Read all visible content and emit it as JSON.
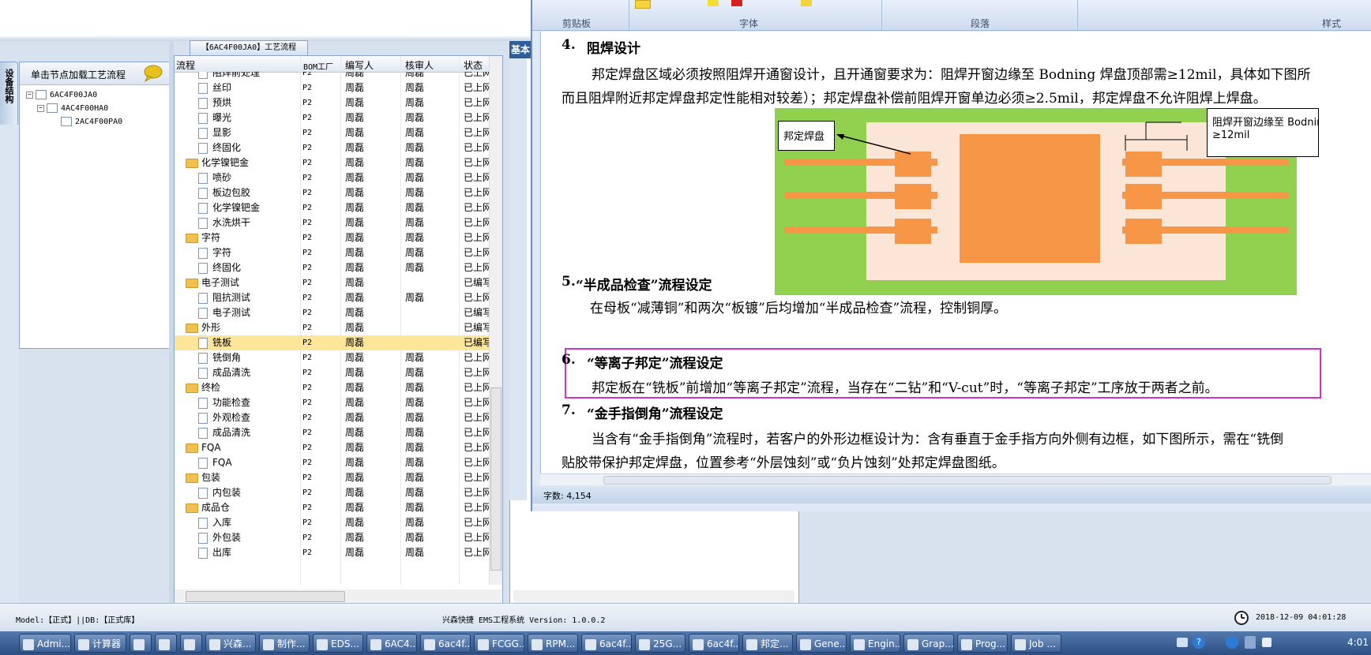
{
  "tree_panel": {
    "side_tab": "设备结构",
    "header": "单击节点加载工艺流程",
    "nodes": [
      "6AC4F00JA0",
      "4AC4F00HA0",
      "2AC4F00PA0"
    ]
  },
  "process": {
    "title": "【6AC4F00JA0】工艺流程",
    "headers": {
      "flow": "流程",
      "bom": "BOM工厂",
      "writer": "编写人",
      "reviewer": "核审人",
      "status": "状态"
    },
    "rows": [
      {
        "level": 2,
        "folder": false,
        "name": "阻焊前处理",
        "bom": "P2",
        "writer": "周磊",
        "reviewer": "周磊",
        "status": "已上网"
      },
      {
        "level": 2,
        "folder": false,
        "name": "丝印",
        "bom": "P2",
        "writer": "周磊",
        "reviewer": "周磊",
        "status": "已上网"
      },
      {
        "level": 2,
        "folder": false,
        "name": "预烘",
        "bom": "P2",
        "writer": "周磊",
        "reviewer": "周磊",
        "status": "已上网"
      },
      {
        "level": 2,
        "folder": false,
        "name": "曝光",
        "bom": "P2",
        "writer": "周磊",
        "reviewer": "周磊",
        "status": "已上网"
      },
      {
        "level": 2,
        "folder": false,
        "name": "显影",
        "bom": "P2",
        "writer": "周磊",
        "reviewer": "周磊",
        "status": "已上网"
      },
      {
        "level": 2,
        "folder": false,
        "name": "终固化",
        "bom": "P2",
        "writer": "周磊",
        "reviewer": "周磊",
        "status": "已上网"
      },
      {
        "level": 1,
        "folder": true,
        "name": "化学镍钯金",
        "bom": "P2",
        "writer": "周磊",
        "reviewer": "周磊",
        "status": "已上网"
      },
      {
        "level": 2,
        "folder": false,
        "name": "喷砂",
        "bom": "P2",
        "writer": "周磊",
        "reviewer": "周磊",
        "status": "已上网"
      },
      {
        "level": 2,
        "folder": false,
        "name": "板边包胶",
        "bom": "P2",
        "writer": "周磊",
        "reviewer": "周磊",
        "status": "已上网"
      },
      {
        "level": 2,
        "folder": false,
        "name": "化学镍钯金",
        "bom": "P2",
        "writer": "周磊",
        "reviewer": "周磊",
        "status": "已上网"
      },
      {
        "level": 2,
        "folder": false,
        "name": "水洗烘干",
        "bom": "P2",
        "writer": "周磊",
        "reviewer": "周磊",
        "status": "已上网"
      },
      {
        "level": 1,
        "folder": true,
        "name": "字符",
        "bom": "P2",
        "writer": "周磊",
        "reviewer": "周磊",
        "status": "已上网"
      },
      {
        "level": 2,
        "folder": false,
        "name": "字符",
        "bom": "P2",
        "writer": "周磊",
        "reviewer": "周磊",
        "status": "已上网"
      },
      {
        "level": 2,
        "folder": false,
        "name": "终固化",
        "bom": "P2",
        "writer": "周磊",
        "reviewer": "周磊",
        "status": "已上网"
      },
      {
        "level": 1,
        "folder": true,
        "name": "电子测试",
        "bom": "P2",
        "writer": "周磊",
        "reviewer": "",
        "status": "已编写"
      },
      {
        "level": 2,
        "folder": false,
        "name": "阻抗测试",
        "bom": "P2",
        "writer": "周磊",
        "reviewer": "周磊",
        "status": "已上网"
      },
      {
        "level": 2,
        "folder": false,
        "name": "电子测试",
        "bom": "P2",
        "writer": "周磊",
        "reviewer": "",
        "status": "已编写"
      },
      {
        "level": 1,
        "folder": true,
        "name": "外形",
        "bom": "P2",
        "writer": "周磊",
        "reviewer": "",
        "status": "已编写"
      },
      {
        "level": 2,
        "folder": false,
        "name": "铣板",
        "bom": "P2",
        "writer": "周磊",
        "reviewer": "",
        "status": "已编写",
        "selected": true
      },
      {
        "level": 2,
        "folder": false,
        "name": "铣倒角",
        "bom": "P2",
        "writer": "周磊",
        "reviewer": "周磊",
        "status": "已上网"
      },
      {
        "level": 2,
        "folder": false,
        "name": "成品清洗",
        "bom": "P2",
        "writer": "周磊",
        "reviewer": "周磊",
        "status": "已上网"
      },
      {
        "level": 1,
        "folder": true,
        "name": "终检",
        "bom": "P2",
        "writer": "周磊",
        "reviewer": "周磊",
        "status": "已上网"
      },
      {
        "level": 2,
        "folder": false,
        "name": "功能检查",
        "bom": "P2",
        "writer": "周磊",
        "reviewer": "周磊",
        "status": "已上网"
      },
      {
        "level": 2,
        "folder": false,
        "name": "外观检查",
        "bom": "P2",
        "writer": "周磊",
        "reviewer": "周磊",
        "status": "已上网"
      },
      {
        "level": 2,
        "folder": false,
        "name": "成品清洗",
        "bom": "P2",
        "writer": "周磊",
        "reviewer": "周磊",
        "status": "已上网"
      },
      {
        "level": 1,
        "folder": true,
        "name": "FQA",
        "bom": "P2",
        "writer": "周磊",
        "reviewer": "周磊",
        "status": "已上网"
      },
      {
        "level": 2,
        "folder": false,
        "name": "FQA",
        "bom": "P2",
        "writer": "周磊",
        "reviewer": "周磊",
        "status": "已上网"
      },
      {
        "level": 1,
        "folder": true,
        "name": "包装",
        "bom": "P2",
        "writer": "周磊",
        "reviewer": "周磊",
        "status": "已上网"
      },
      {
        "level": 2,
        "folder": false,
        "name": "内包装",
        "bom": "P2",
        "writer": "周磊",
        "reviewer": "周磊",
        "status": "已上网"
      },
      {
        "level": 1,
        "folder": true,
        "name": "成品仓",
        "bom": "P2",
        "writer": "周磊",
        "reviewer": "周磊",
        "status": "已上网"
      },
      {
        "level": 2,
        "folder": false,
        "name": "入库",
        "bom": "P2",
        "writer": "周磊",
        "reviewer": "周磊",
        "status": "已上网"
      },
      {
        "level": 2,
        "folder": false,
        "name": "外包装",
        "bom": "P2",
        "writer": "周磊",
        "reviewer": "周磊",
        "status": "已上网"
      },
      {
        "level": 2,
        "folder": false,
        "name": "出库",
        "bom": "P2",
        "writer": "周磊",
        "reviewer": "周磊",
        "status": "已上网"
      }
    ]
  },
  "middle": {
    "tab": "基本"
  },
  "word": {
    "ribbon": {
      "clipboard": "剪贴板",
      "font": "字体",
      "paragraph": "段落",
      "styles": "样式"
    },
    "doc": {
      "s4_num": "4.",
      "s4_title": "阻焊设计",
      "s4_p1": "邦定焊盘区域必须按照阻焊开通窗设计，且开通窗要求为：阻焊开窗边缘至 Bodning 焊盘顶部需≥12mil，具体如下图所",
      "s4_p2": "而且阻焊附近邦定焊盘邦定性能相对较差）；邦定焊盘补偿前阻焊开窗单边必须≥2.5mil，邦定焊盘不允许阻焊上焊盘。",
      "diagram_label_pad": "邦定焊盘",
      "diagram_label_note1": "阻焊开窗边缘至 Bodning 焊",
      "diagram_label_note2": "≥12mil",
      "s5_num": "5.",
      "s5_title": "“半成品检查”流程设定",
      "s5_p": "在母板“减薄铜”和两次“板镀”后均增加“半成品检查”流程，控制铜厚。",
      "s6_num": "6.",
      "s6_title": "“等离子邦定”流程设定",
      "s6_p": "邦定板在“铣板”前增加“等离子邦定”流程，当存在“二钻”和“V-cut”时，“等离子邦定”工序放于两者之前。",
      "s7_num": "7.",
      "s7_title": "“金手指倒角”流程设定",
      "s7_p1": "当含有“金手指倒角”流程时，若客户的外形边框设计为：含有垂直于金手指方向外侧有边框，如下图所示，需在“铣倒",
      "s7_p2": "贴胶带保护邦定焊盘，位置参考“外层蚀刻”或“负片蚀刻”处邦定焊盘图纸。"
    },
    "status": "字数: 4,154",
    "highlight_color": "#cc33cc"
  },
  "app_status": {
    "model": "Model:【正式】||DB:【正式库】",
    "system": "兴森快捷 EMS工程系统 Version: 1.0.0.2",
    "datetime": "2018-12-09 04:01:28"
  },
  "taskbar": {
    "items": [
      "Admi...",
      "计算器",
      "",
      "",
      "",
      "兴森...",
      "制作...",
      "EDS...",
      "6AC4...",
      "6ac4f...",
      "FCGG...",
      "RPM...",
      "6ac4f...",
      "25G...",
      "6ac4f...",
      "邦定...",
      "Gene...",
      "Engin...",
      "Grap...",
      "Prog...",
      "Job ..."
    ],
    "clock": "4:01"
  }
}
